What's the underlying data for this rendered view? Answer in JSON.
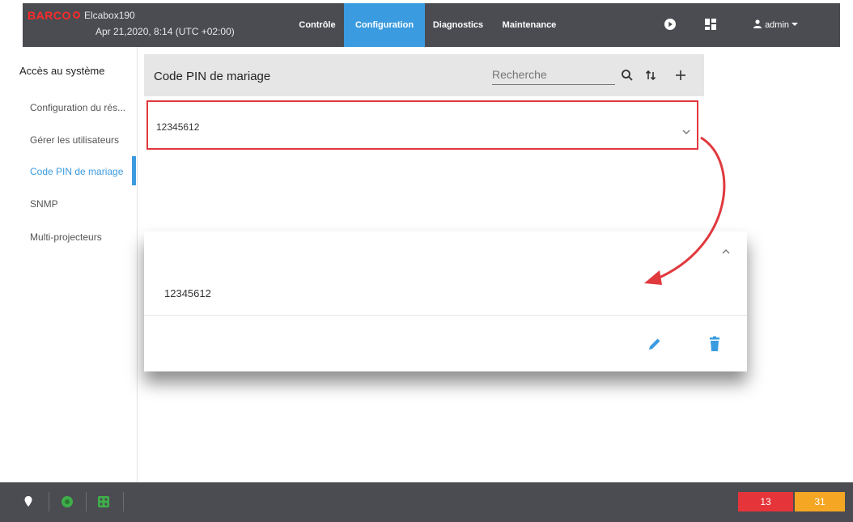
{
  "topbar": {
    "logo": "BARCO",
    "device_name": "Elcabox190",
    "datetime": "Apr 21,2020, 8:14 (UTC +02:00)",
    "nav": [
      {
        "label": "Contrôle"
      },
      {
        "label": "Configuration"
      },
      {
        "label": "Diagnostics"
      },
      {
        "label": "Maintenance"
      }
    ],
    "active_nav": "Configuration",
    "user": "admin",
    "accent_color": "#3b9be0"
  },
  "sidebar": {
    "title": "Accès au système",
    "items": [
      {
        "label": "Configuration du rés..."
      },
      {
        "label": "Gérer les utilisateurs"
      },
      {
        "label": "Code PIN de mariage"
      },
      {
        "label": "SNMP"
      },
      {
        "label": "Multi-projecteurs"
      }
    ],
    "active_item": "Code PIN de mariage"
  },
  "panel": {
    "title": "Code PIN de mariage",
    "search_placeholder": "Recherche",
    "icons": [
      "search-icon",
      "sort-icon",
      "add-icon"
    ]
  },
  "pin_row": {
    "value": "12345612",
    "expanded_value": "12345612",
    "highlight_color": "#e0393e"
  },
  "card_actions": {
    "icons": [
      "edit-icon",
      "delete-icon"
    ]
  },
  "statusbar": {
    "icons": [
      "location-icon",
      "power-icon",
      "module-icon"
    ],
    "error_count": "13",
    "warning_count": "31",
    "error_color": "#e6353a",
    "warning_color": "#f5a623"
  }
}
